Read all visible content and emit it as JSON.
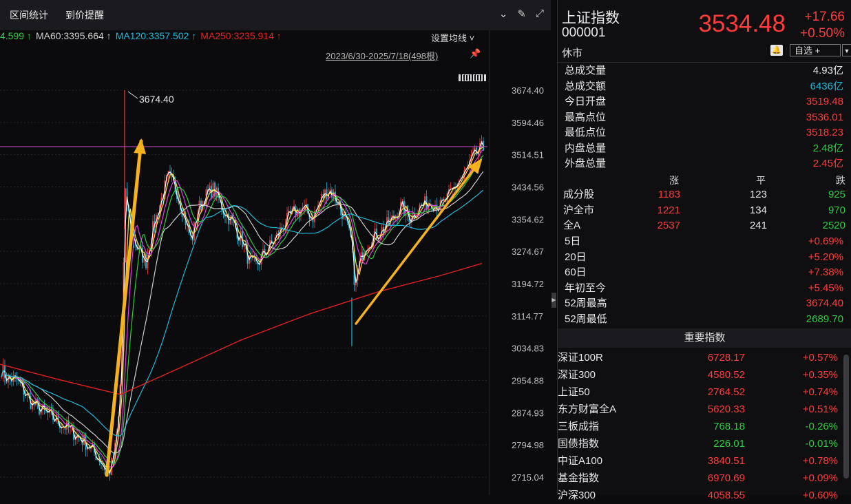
{
  "toolbar": {
    "tabs": [
      "区间统计",
      "到价提醒"
    ],
    "icons": [
      "chevron-down-circle-icon",
      "brush-icon",
      "expand-icon"
    ]
  },
  "ma_legend": [
    {
      "text": "4.599 ↑",
      "color": "#2ecc40"
    },
    {
      "text": "MA60:3395.664 ↑",
      "color": "#cfcfcf"
    },
    {
      "text": "MA120:3357.502 ↑",
      "color": "#1fb8d8"
    },
    {
      "text": "MA250:3235.914 ↑",
      "color": "#e02020"
    }
  ],
  "chart_controls": {
    "settings_label": "设置均线 ˅",
    "range_label": "2023/6/30-2025/7/18(498根)"
  },
  "chart_data": {
    "type": "line",
    "annotation_high": "3674.40",
    "y_ticks": [
      "3674.40",
      "3594.46",
      "3514.51",
      "3434.56",
      "3354.62",
      "3274.67",
      "3194.72",
      "3114.77",
      "3034.83",
      "2954.88",
      "2874.93",
      "2794.98",
      "2715.04"
    ],
    "ylim": [
      2715.04,
      3674.4
    ],
    "reference_line": 3534.48,
    "colors": {
      "up": "#ff3b3b",
      "down": "#1fb8d8",
      "ma5": "#ffffff",
      "ma10": "#f5e642",
      "ma20": "#e040e0",
      "ma30": "#2ecc40",
      "ma60": "#cfcfcf",
      "ma120": "#1fb8d8",
      "ma250": "#e02020",
      "arrow": "#f5b21c"
    }
  },
  "quote": {
    "name": "上证指数",
    "code": "000001",
    "status": "休市",
    "price": "3534.48",
    "change": "+17.66",
    "change_pct": "+0.50%",
    "watch_label": "自选 +"
  },
  "stats": [
    {
      "label": "总成交量",
      "value": "4.93亿",
      "color": "#e8e8e8"
    },
    {
      "label": "总成交额",
      "value": "6436亿",
      "color": "#1fb8d8"
    },
    {
      "label": "今日开盘",
      "value": "3519.48",
      "color": "#ff3b3b"
    },
    {
      "label": "最高点位",
      "value": "3536.01",
      "color": "#ff3b3b"
    },
    {
      "label": "最低点位",
      "value": "3518.23",
      "color": "#ff3b3b"
    },
    {
      "label": "内盘总量",
      "value": "2.48亿",
      "color": "#2ecc40"
    },
    {
      "label": "外盘总量",
      "value": "2.45亿",
      "color": "#ff3b3b"
    }
  ],
  "breadth": {
    "headers": [
      "涨",
      "平",
      "跌"
    ],
    "rows": [
      {
        "label": "成分股",
        "up": "1183",
        "flat": "123",
        "down": "925"
      },
      {
        "label": "沪全市",
        "up": "1221",
        "flat": "134",
        "down": "970"
      },
      {
        "label": "全A",
        "up": "2537",
        "flat": "241",
        "down": "2520"
      }
    ]
  },
  "periods": [
    {
      "label": "5日",
      "value": "+0.69%",
      "color": "#ff3b3b"
    },
    {
      "label": "20日",
      "value": "+5.20%",
      "color": "#ff3b3b"
    },
    {
      "label": "60日",
      "value": "+7.38%",
      "color": "#ff3b3b"
    },
    {
      "label": "年初至今",
      "value": "+5.45%",
      "color": "#ff3b3b"
    },
    {
      "label": "52周最高",
      "value": "3674.40",
      "color": "#ff3b3b"
    },
    {
      "label": "52周最低",
      "value": "2689.70",
      "color": "#2ecc40"
    }
  ],
  "indices": {
    "title": "重要指数",
    "rows": [
      {
        "name": "深证100R",
        "price": "6728.17",
        "change": "+0.57%",
        "color": "#ff3b3b"
      },
      {
        "name": "深证300",
        "price": "4580.52",
        "change": "+0.35%",
        "color": "#ff3b3b"
      },
      {
        "name": "上证50",
        "price": "2764.52",
        "change": "+0.74%",
        "color": "#ff3b3b"
      },
      {
        "name": "东方财富全A",
        "price": "5620.33",
        "change": "+0.51%",
        "color": "#ff3b3b"
      },
      {
        "name": "三板成指",
        "price": "768.18",
        "change": "-0.26%",
        "color": "#2ecc40"
      },
      {
        "name": "国债指数",
        "price": "226.01",
        "change": "-0.01%",
        "color": "#2ecc40"
      },
      {
        "name": "中证A100",
        "price": "3840.51",
        "change": "+0.78%",
        "color": "#ff3b3b"
      },
      {
        "name": "基金指数",
        "price": "6970.69",
        "change": "+0.09%",
        "color": "#ff3b3b"
      },
      {
        "name": "沪深300",
        "price": "4058.55",
        "change": "+0.60%",
        "color": "#ff3b3b"
      }
    ]
  }
}
